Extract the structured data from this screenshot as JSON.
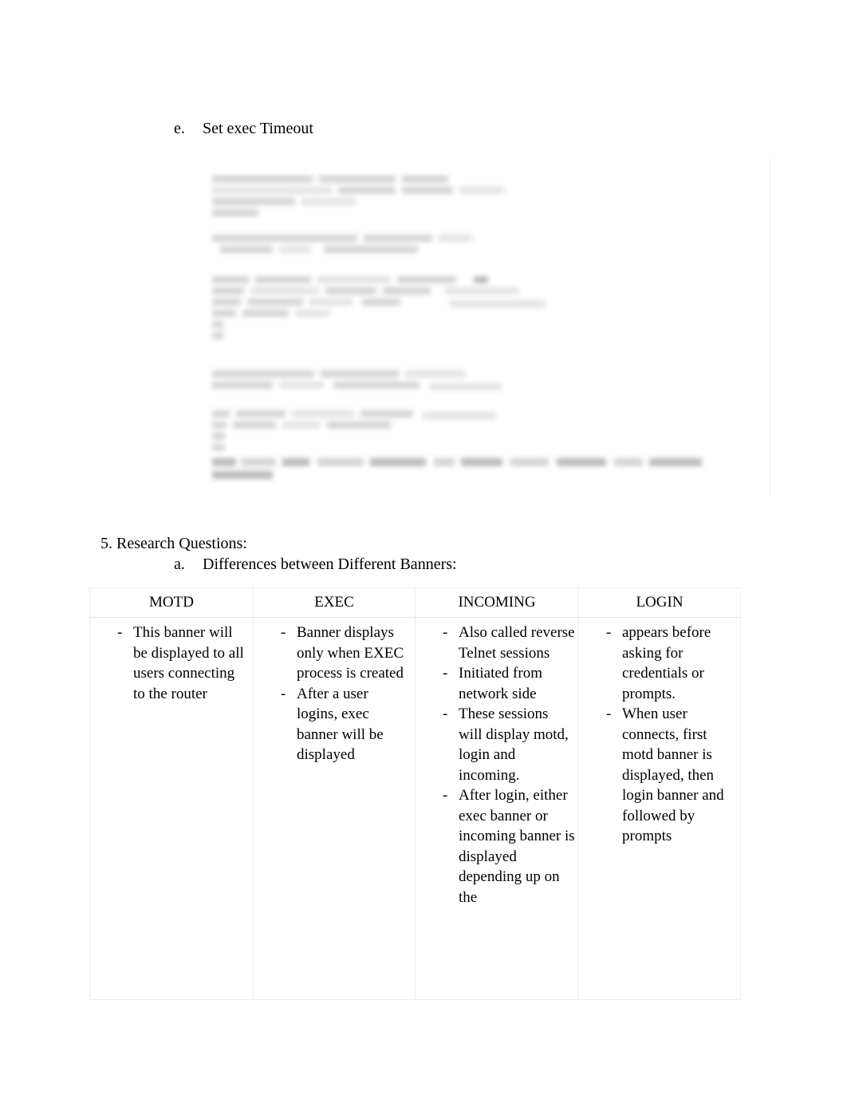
{
  "document": {
    "section_e": {
      "marker": "e.",
      "title": "Set exec Timeout"
    },
    "embedded_screenshot": {
      "name": "set-exec-timeout-terminal-screenshot",
      "state": "blurred"
    },
    "section_5": {
      "heading": "5. Research Questions:",
      "subsection_a": {
        "marker": "a.",
        "title": "Differences between Different Banners:"
      }
    }
  },
  "table": {
    "headers": [
      "MOTD",
      "EXEC",
      "INCOMING",
      "LOGIN"
    ],
    "columns": [
      {
        "header": "MOTD",
        "bullets": [
          "This banner will be displayed to all users connecting to the router"
        ]
      },
      {
        "header": "EXEC",
        "bullets": [
          "Banner displays only when EXEC process is created",
          "After a user logins, exec banner will be displayed"
        ]
      },
      {
        "header": "INCOMING",
        "bullets": [
          "Also called reverse Telnet sessions",
          "Initiated from network side",
          "These sessions will display motd, login and incoming.",
          "After login, either exec banner or incoming banner is displayed depending up on the"
        ]
      },
      {
        "header": "LOGIN",
        "bullets": [
          "appears before asking for credentials or prompts.",
          "When user connects, first motd banner is displayed, then login banner and followed by prompts"
        ]
      }
    ]
  }
}
